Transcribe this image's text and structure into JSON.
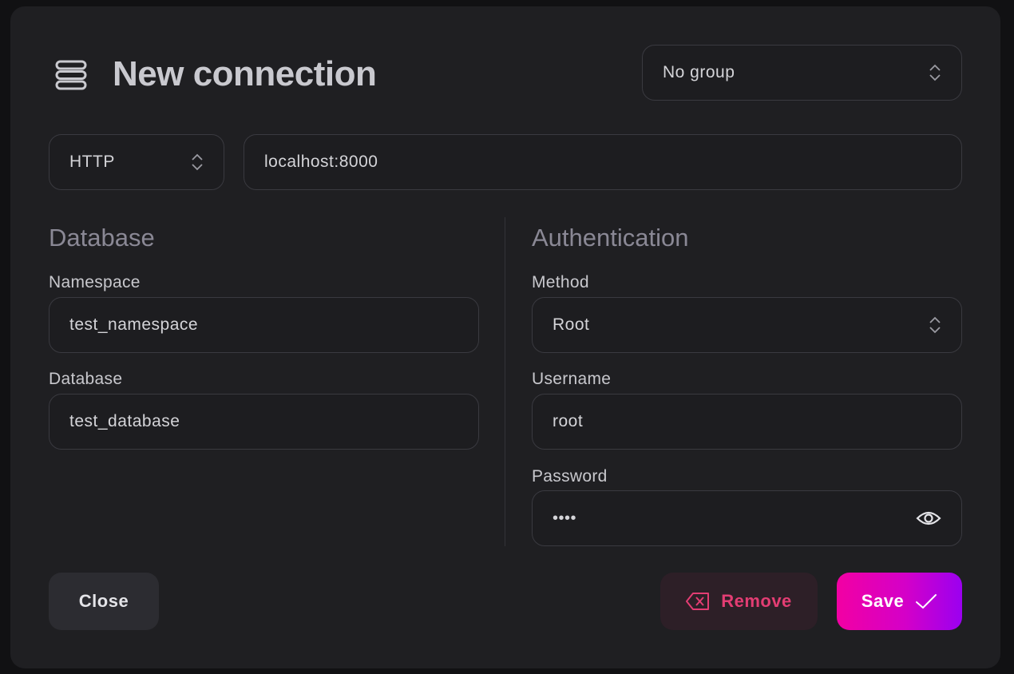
{
  "header": {
    "title": "New connection",
    "icon": "database-icon",
    "group_select": {
      "value": "No group"
    }
  },
  "connection": {
    "protocol": "HTTP",
    "endpoint": "localhost:8000"
  },
  "database_section": {
    "title": "Database",
    "namespace": {
      "label": "Namespace",
      "value": "test_namespace"
    },
    "database": {
      "label": "Database",
      "value": "test_database"
    }
  },
  "auth_section": {
    "title": "Authentication",
    "method": {
      "label": "Method",
      "value": "Root"
    },
    "username": {
      "label": "Username",
      "value": "root"
    },
    "password": {
      "label": "Password",
      "masked_value": "••••",
      "icon": "eye-icon"
    }
  },
  "footer": {
    "close_label": "Close",
    "remove_label": "Remove",
    "save_label": "Save"
  },
  "colors": {
    "accent_start": "#f200a3",
    "accent_end": "#9b00f0",
    "danger": "#e33d73",
    "background": "#1f1f22"
  }
}
